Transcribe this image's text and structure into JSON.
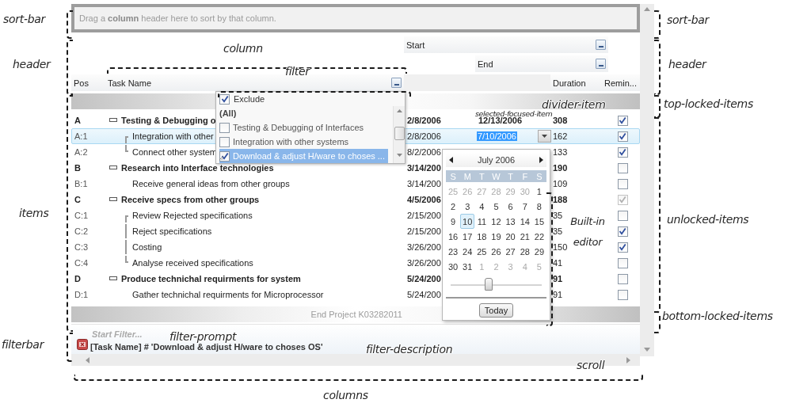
{
  "sort_bar": {
    "prompt": "Drag a **column** header here to sort by that column."
  },
  "header": {
    "start_caption": {
      "label": "Start",
      "filter_button": true
    },
    "end_caption": {
      "label": "End",
      "filter_button": true
    },
    "columns": [
      {
        "kind": "pos",
        "label": "Pos",
        "filter_button": false
      },
      {
        "kind": "task",
        "label": "Task Name",
        "filter_button": true
      },
      {
        "kind": "blank"
      },
      {
        "kind": "duration",
        "label": "Duration",
        "filter_button": false
      },
      {
        "kind": "reminder",
        "label": "Remin...",
        "filter_button": false
      }
    ]
  },
  "items": [
    {
      "pos": "A",
      "task": "Testing & Debugging o",
      "start": "2/8/2006",
      "end": "12/13/2006",
      "duration": "308",
      "reminder": {
        "checked": true,
        "disabled": false
      },
      "selected": false,
      "editing": false,
      "expanded": true,
      "children": [
        {
          "pos": "A:1",
          "task": "Integration with other",
          "start": "2/8/2006",
          "end": "7/10/2006",
          "duration": "162",
          "reminder": {
            "checked": true,
            "disabled": false
          },
          "selected": true,
          "editing": true
        },
        {
          "pos": "A:2",
          "task": "Connect other system",
          "start": "8/2/2006",
          "duration": "133",
          "reminder": {
            "checked": true,
            "disabled": false
          },
          "selected": false,
          "editing": false
        }
      ]
    },
    {
      "pos": "B",
      "task": "Research into Interface technologies",
      "start": "3/14/200",
      "duration": "190",
      "reminder": {
        "checked": false,
        "disabled": false
      },
      "selected": false,
      "editing": false,
      "expanded": true,
      "children": [
        {
          "pos": "B:1",
          "task": "Receive general ideas from other groups",
          "start": "3/14/200",
          "duration": "109",
          "reminder": {
            "checked": false,
            "disabled": false
          },
          "selected": false,
          "editing": false
        }
      ]
    },
    {
      "pos": "C",
      "task": "Receive specs from other groups",
      "start": "4/5/2006",
      "duration": "188",
      "reminder": {
        "checked": true,
        "disabled": true
      },
      "selected": false,
      "editing": false,
      "expanded": true,
      "children": [
        {
          "pos": "C:1",
          "task": "Review Rejected specifications",
          "start": "2/15/200",
          "duration": "35",
          "reminder": {
            "checked": false,
            "disabled": false
          },
          "selected": false,
          "editing": false
        },
        {
          "pos": "C:2",
          "task": "Reject specifications",
          "start": "2/15/200",
          "duration": "35",
          "reminder": {
            "checked": true,
            "disabled": false
          },
          "selected": false,
          "editing": false
        },
        {
          "pos": "C:3",
          "task": "Costing",
          "start": "3/26/200",
          "duration": "150",
          "reminder": {
            "checked": true,
            "disabled": false
          },
          "selected": false,
          "editing": false
        },
        {
          "pos": "C:4",
          "task": "Analyse received specifications",
          "start": "3/26/200",
          "duration": "41",
          "reminder": {
            "checked": false,
            "disabled": false
          },
          "selected": false,
          "editing": false
        }
      ]
    },
    {
      "pos": "D",
      "task": "Produce technichal requirments for system",
      "start": "5/24/200",
      "duration": "91",
      "reminder": {
        "checked": false,
        "disabled": false
      },
      "selected": false,
      "editing": false,
      "expanded": true,
      "children": [
        {
          "pos": "D:1",
          "task": "Gather technichal requirments for Microprocessor",
          "start": "5/24/200",
          "duration": "91",
          "reminder": {
            "checked": false,
            "disabled": false
          },
          "selected": false,
          "editing": false
        }
      ]
    }
  ],
  "bottom_divider": {
    "text": "End Project K03282011"
  },
  "filter_popup": {
    "exclude": {
      "label": "Exclude",
      "checked": true
    },
    "all_label": "(All)",
    "options": [
      {
        "label": "Testing & Debugging of Interfaces",
        "checked": false,
        "selected": false
      },
      {
        "label": "Integration with other systems",
        "checked": false,
        "selected": false
      },
      {
        "label": "Download & adjust H/ware to choses ...",
        "checked": true,
        "selected": true
      }
    ]
  },
  "editor_calendar": {
    "month": "July 2006",
    "weekdays": [
      "S",
      "M",
      "T",
      "W",
      "T",
      "F",
      "S"
    ],
    "days": [
      {
        "label": "25",
        "other_month": true,
        "selected": false
      },
      {
        "label": "26",
        "other_month": true,
        "selected": false
      },
      {
        "label": "27",
        "other_month": true,
        "selected": false
      },
      {
        "label": "28",
        "other_month": true,
        "selected": false
      },
      {
        "label": "29",
        "other_month": true,
        "selected": false
      },
      {
        "label": "30",
        "other_month": true,
        "selected": false
      },
      {
        "label": "1",
        "other_month": false,
        "selected": false
      },
      {
        "label": "2",
        "other_month": false,
        "selected": false
      },
      {
        "label": "3",
        "other_month": false,
        "selected": false
      },
      {
        "label": "4",
        "other_month": false,
        "selected": false
      },
      {
        "label": "5",
        "other_month": false,
        "selected": false
      },
      {
        "label": "6",
        "other_month": false,
        "selected": false
      },
      {
        "label": "7",
        "other_month": false,
        "selected": false
      },
      {
        "label": "8",
        "other_month": false,
        "selected": false
      },
      {
        "label": "9",
        "other_month": false,
        "selected": false
      },
      {
        "label": "10",
        "other_month": false,
        "selected": true
      },
      {
        "label": "11",
        "other_month": false,
        "selected": false
      },
      {
        "label": "12",
        "other_month": false,
        "selected": false
      },
      {
        "label": "13",
        "other_month": false,
        "selected": false
      },
      {
        "label": "14",
        "other_month": false,
        "selected": false
      },
      {
        "label": "15",
        "other_month": false,
        "selected": false
      },
      {
        "label": "16",
        "other_month": false,
        "selected": false
      },
      {
        "label": "17",
        "other_month": false,
        "selected": false
      },
      {
        "label": "18",
        "other_month": false,
        "selected": false
      },
      {
        "label": "19",
        "other_month": false,
        "selected": false
      },
      {
        "label": "20",
        "other_month": false,
        "selected": false
      },
      {
        "label": "21",
        "other_month": false,
        "selected": false
      },
      {
        "label": "22",
        "other_month": false,
        "selected": false
      },
      {
        "label": "23",
        "other_month": false,
        "selected": false
      },
      {
        "label": "24",
        "other_month": false,
        "selected": false
      },
      {
        "label": "25",
        "other_month": false,
        "selected": false
      },
      {
        "label": "26",
        "other_month": false,
        "selected": false
      },
      {
        "label": "27",
        "other_month": false,
        "selected": false
      },
      {
        "label": "28",
        "other_month": false,
        "selected": false
      },
      {
        "label": "29",
        "other_month": false,
        "selected": false
      },
      {
        "label": "30",
        "other_month": false,
        "selected": false
      },
      {
        "label": "31",
        "other_month": false,
        "selected": false
      },
      {
        "label": "1",
        "other_month": true,
        "selected": false
      },
      {
        "label": "2",
        "other_month": true,
        "selected": false
      },
      {
        "label": "3",
        "other_month": true,
        "selected": false
      },
      {
        "label": "4",
        "other_month": true,
        "selected": false
      },
      {
        "label": "5",
        "other_month": true,
        "selected": false
      }
    ],
    "slider": {
      "level": 0.42
    },
    "today_button": "Today"
  },
  "filter_bar": {
    "prompt": "Start Filter...",
    "description": "[Task Name] # 'Download & adjust H/ware to choses OS'"
  },
  "annotations": [
    "sort-bar",
    "sort-bar",
    "header",
    "header",
    "column",
    "filter",
    "divider-item",
    "top-locked-items",
    "selected-focused-item",
    "items",
    "unlocked-items",
    "Built-in editor",
    "bottom-locked-items",
    "filterbar",
    "filter-prompt",
    "filter-description",
    "scroll",
    "columns"
  ]
}
